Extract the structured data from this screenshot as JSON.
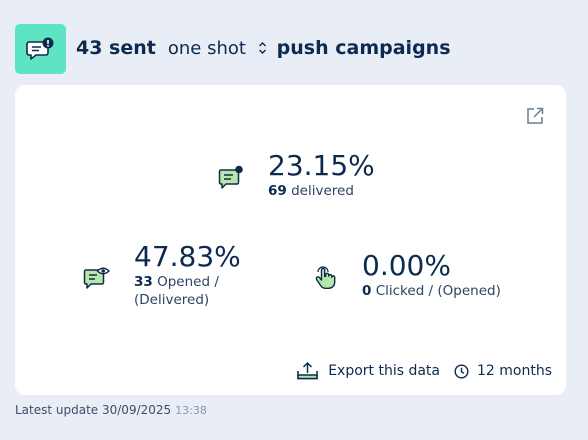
{
  "header": {
    "count": "43 sent",
    "mode": "one shot",
    "title": "push campaigns"
  },
  "stats": {
    "delivered": {
      "percent": "23.15%",
      "count": "69",
      "label": "delivered"
    },
    "opened": {
      "percent": "47.83%",
      "count": "33",
      "label_line1": "Opened /",
      "label_line2": "(Delivered)"
    },
    "clicked": {
      "percent": "0.00%",
      "count": "0",
      "label": "Clicked / (Opened)"
    }
  },
  "footer": {
    "export_label": "Export this data",
    "period_label": "12 months"
  },
  "update": {
    "label": "Latest update 30/09/2025",
    "time": "13:38"
  },
  "icons": {
    "header": "push-message-icon",
    "delivered": "message-dot-icon",
    "opened": "message-eye-icon",
    "clicked": "tap-hand-icon",
    "external": "external-link-icon",
    "export": "upload-tray-icon",
    "period": "clock-icon",
    "mode": "up-down-chevron-icon"
  },
  "colors": {
    "background": "#e9eef6",
    "card": "#ffffff",
    "accent_teal": "#5fe3c5",
    "icon_green": "#b8e6a8",
    "navy": "#0d2a4f"
  }
}
